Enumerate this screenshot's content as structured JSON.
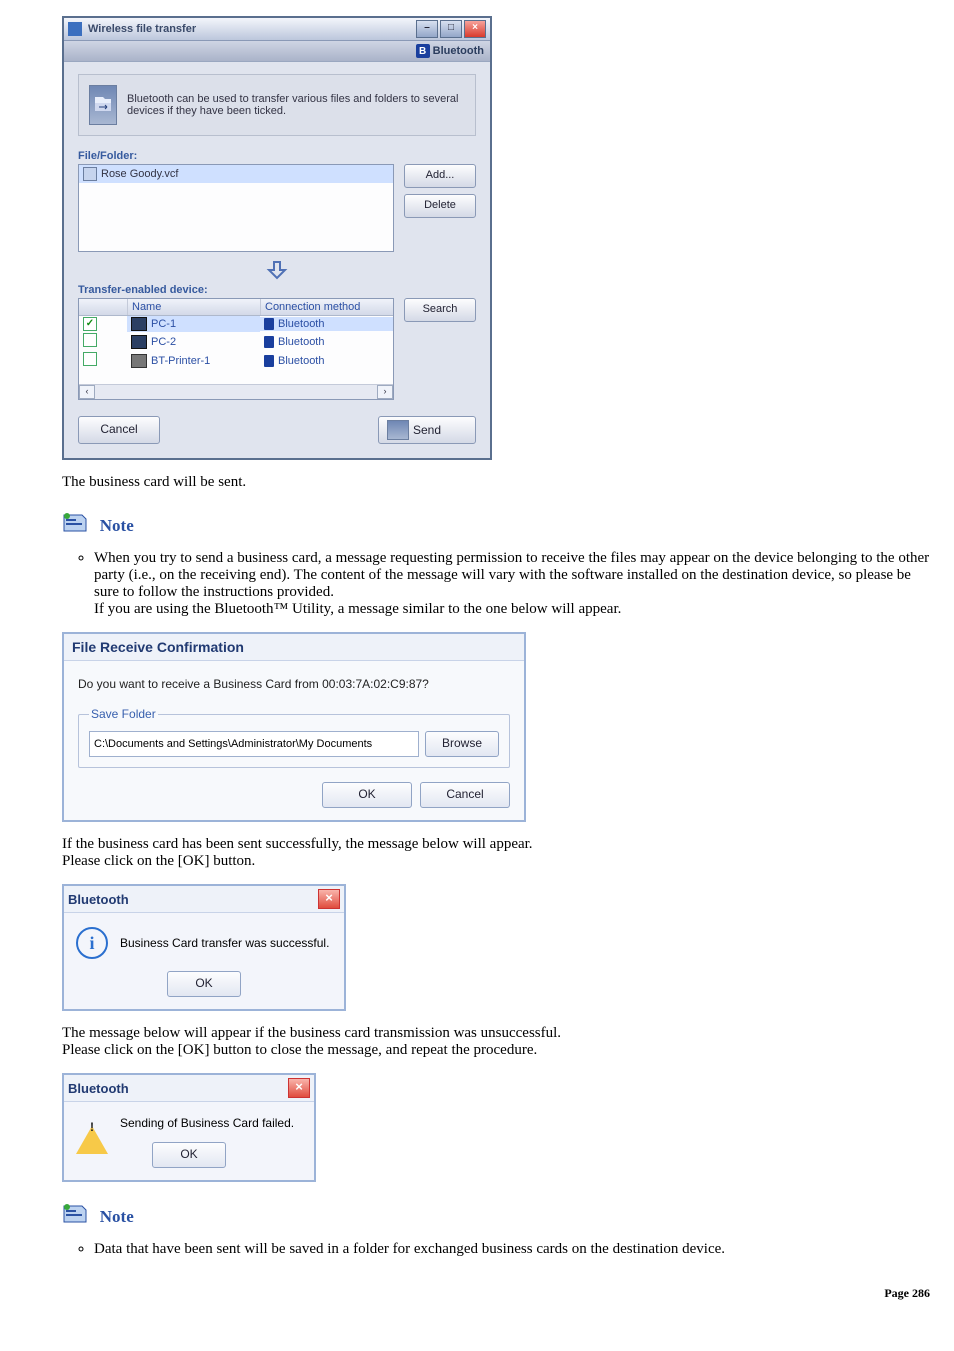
{
  "win1": {
    "title": "Wireless file transfer",
    "brand": "Bluetooth",
    "info": "Bluetooth can be used to transfer various files and folders to several devices if they have been ticked.",
    "fileFolderLabel": "File/Folder:",
    "fileItem": "Rose Goody.vcf",
    "addBtn": "Add...",
    "deleteBtn": "Delete",
    "transferLabel": "Transfer-enabled device:",
    "colName": "Name",
    "colConn": "Connection method",
    "searchBtn": "Search",
    "rows": [
      {
        "checked": true,
        "name": "PC-1",
        "conn": "Bluetooth",
        "icon": "pc"
      },
      {
        "checked": false,
        "name": "PC-2",
        "conn": "Bluetooth",
        "icon": "pc"
      },
      {
        "checked": false,
        "name": "BT-Printer-1",
        "conn": "Bluetooth",
        "icon": "printer"
      }
    ],
    "cancel": "Cancel",
    "send": "Send"
  },
  "para1": "The business card will be sent.",
  "noteLabel": "Note",
  "note1a": "When you try to send a business card, a message requesting permission to receive the files may appear on the device belonging to the other party (i.e., on the receiving end). The content of the message will vary with the software installed on the destination device, so please be sure to follow the instructions provided.",
  "note1b": "If you are using the Bluetooth™ Utility, a message similar to the one below will appear.",
  "dlg2": {
    "title": "File Receive Confirmation",
    "question": "Do you want to receive a Business Card from 00:03:7A:02:C9:87?",
    "legend": "Save Folder",
    "path": "C:\\Documents and Settings\\Administrator\\My Documents",
    "browse": "Browse",
    "ok": "OK",
    "cancel": "Cancel"
  },
  "para2a": "If the business card has been sent successfully, the message below will appear.",
  "para2b": "Please click on the [OK] button.",
  "mbox1": {
    "title": "Bluetooth",
    "msg": "Business Card transfer was successful.",
    "ok": "OK"
  },
  "para3a": "The message below will appear if the business card transmission was unsuccessful.",
  "para3b": "Please click on the [OK] button to close the message, and repeat the procedure.",
  "mbox2": {
    "title": "Bluetooth",
    "msg": "Sending of Business Card failed.",
    "ok": "OK"
  },
  "note2": "Data that have been sent will be saved in a folder for exchanged business cards on the destination device.",
  "pageLabel": "Page 286"
}
